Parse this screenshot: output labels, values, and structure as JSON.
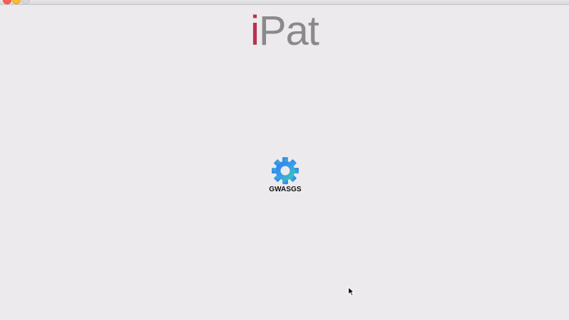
{
  "logo": {
    "first_letter": "i",
    "rest": "Pat",
    "accent_color": "#b8304f",
    "text_color": "#8a898b"
  },
  "app": {
    "label": "GWASGS",
    "icon": "gear-icon"
  },
  "pointer": {
    "icon": "mouse-pointer-icon"
  }
}
